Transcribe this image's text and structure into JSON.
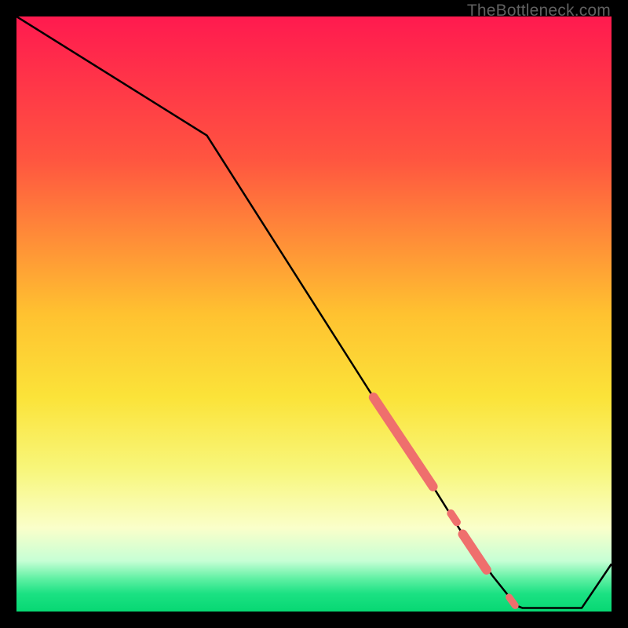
{
  "watermark": "TheBottleneck.com",
  "chart_data": {
    "type": "line",
    "title": "",
    "xlabel": "",
    "ylabel": "",
    "xlim": [
      0,
      100
    ],
    "ylim": [
      0,
      100
    ],
    "gradient_stops": [
      {
        "offset": 0,
        "color": "#ff1a4f"
      },
      {
        "offset": 0.24,
        "color": "#ff5540"
      },
      {
        "offset": 0.5,
        "color": "#ffc230"
      },
      {
        "offset": 0.64,
        "color": "#fbe339"
      },
      {
        "offset": 0.76,
        "color": "#f8f67a"
      },
      {
        "offset": 0.86,
        "color": "#faffca"
      },
      {
        "offset": 0.915,
        "color": "#c6ffd5"
      },
      {
        "offset": 0.945,
        "color": "#5ff0a3"
      },
      {
        "offset": 0.97,
        "color": "#1be183"
      },
      {
        "offset": 1.0,
        "color": "#07d873"
      }
    ],
    "series": [
      {
        "name": "curve",
        "color": "#000000",
        "x": [
          0,
          32,
          60,
          70,
          75,
          80,
          84,
          85,
          90,
          95,
          100
        ],
        "y": [
          100,
          80,
          36,
          21,
          13,
          6,
          1,
          0.6,
          0.6,
          0.6,
          8
        ]
      }
    ],
    "highlight_segments": [
      {
        "x1": 60,
        "y1": 36,
        "x2": 70,
        "y2": 21,
        "width": 12,
        "color": "#ef6f6d"
      },
      {
        "x1": 73,
        "y1": 16.5,
        "x2": 74,
        "y2": 15,
        "width": 10,
        "color": "#ef6f6d"
      },
      {
        "x1": 75,
        "y1": 13,
        "x2": 79,
        "y2": 7,
        "width": 12,
        "color": "#ef6f6d"
      },
      {
        "x1": 82.8,
        "y1": 2.4,
        "x2": 83.8,
        "y2": 1.0,
        "width": 9,
        "color": "#ef6f6d"
      }
    ]
  }
}
